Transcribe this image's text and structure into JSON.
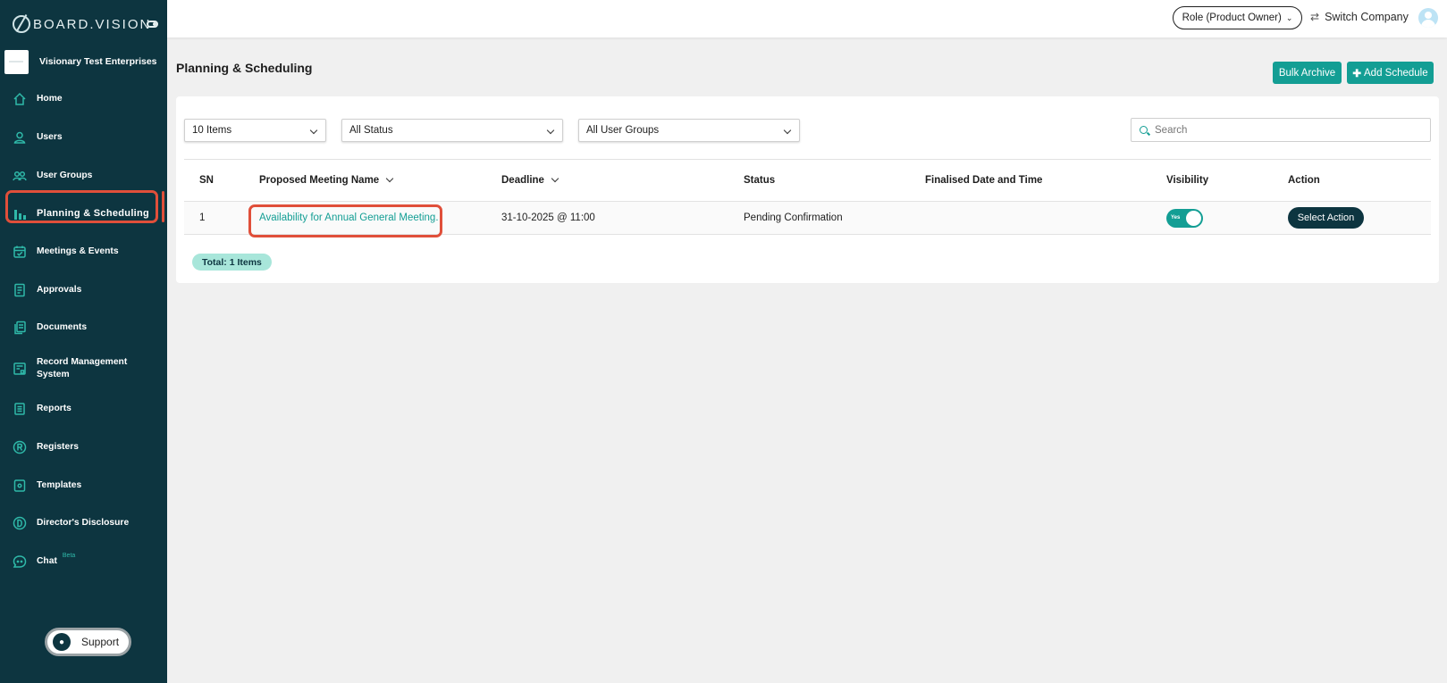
{
  "app": {
    "logo_text": "BOARD.VISION",
    "company_name": "Visionary Test Enterprises"
  },
  "sidebar": {
    "items": [
      {
        "label": "Home",
        "icon": "home-icon"
      },
      {
        "label": "Users",
        "icon": "user-icon"
      },
      {
        "label": "User Groups",
        "icon": "users-icon"
      },
      {
        "label": "Planning & Scheduling",
        "icon": "bar-chart-icon",
        "active": true
      },
      {
        "label": "Meetings & Events",
        "icon": "calendar-icon"
      },
      {
        "label": "Approvals",
        "icon": "approvals-icon"
      },
      {
        "label": "Documents",
        "icon": "documents-icon"
      },
      {
        "label": "Record Management System",
        "icon": "records-icon"
      },
      {
        "label": "Reports",
        "icon": "reports-icon"
      },
      {
        "label": "Registers",
        "icon": "registers-icon"
      },
      {
        "label": "Templates",
        "icon": "templates-icon"
      },
      {
        "label": "Director's Disclosure",
        "icon": "disclosure-icon"
      },
      {
        "label": "Chat",
        "icon": "chat-icon",
        "badge": "Beta"
      }
    ],
    "support_label": "Support"
  },
  "topbar": {
    "role_label": "Role (Product Owner)",
    "switch_company_label": "Switch Company"
  },
  "page": {
    "title": "Planning & Scheduling",
    "bulk_archive_label": "Bulk Archive",
    "add_schedule_label": "Add Schedule"
  },
  "filters": {
    "items_per_page": "10 Items",
    "status": "All Status",
    "user_groups": "All User Groups",
    "search_placeholder": "Search"
  },
  "table": {
    "headers": {
      "sn": "SN",
      "name": "Proposed Meeting Name",
      "deadline": "Deadline",
      "status": "Status",
      "finalised": "Finalised Date and Time",
      "visibility": "Visibility",
      "action": "Action"
    },
    "rows": [
      {
        "sn": "1",
        "name": "Availability for Annual General Meeting.",
        "deadline": "31-10-2025 @ 11:00",
        "status": "Pending Confirmation",
        "finalised": "",
        "visibility": "Yes",
        "action": "Select Action"
      }
    ],
    "total": "Total: 1 Items"
  },
  "colors": {
    "sidebar_bg": "#0d3540",
    "accent": "#139e94",
    "highlight": "#e04f3a"
  }
}
